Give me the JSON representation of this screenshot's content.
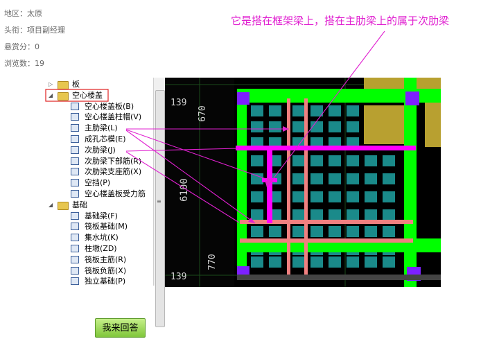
{
  "info": {
    "region": "地区：太原",
    "title": "头衔：项目副经理",
    "reward": "悬赏分：0",
    "views": "浏览数：19"
  },
  "annotation": "它是搭在框架梁上，搭在主肋梁上的属于次肋梁",
  "tree": {
    "items": [
      {
        "label": "板",
        "level": 0,
        "folder": true,
        "expanded": false
      },
      {
        "label": "空心楼盖",
        "level": 0,
        "folder": true,
        "expanded": true
      },
      {
        "label": "空心楼盖板(B)",
        "level": 1
      },
      {
        "label": "空心楼盖柱帽(V)",
        "level": 1
      },
      {
        "label": "主肋梁(L)",
        "level": 1
      },
      {
        "label": "成孔芯模(E)",
        "level": 1
      },
      {
        "label": "次肋梁(J)",
        "level": 1
      },
      {
        "label": "次肋梁下部筋(R)",
        "level": 1
      },
      {
        "label": "次肋梁支座筋(X)",
        "level": 1
      },
      {
        "label": "空挡(P)",
        "level": 1
      },
      {
        "label": "空心楼盖板受力筋",
        "level": 1
      },
      {
        "label": "基础",
        "level": 0,
        "folder": true,
        "expanded": true
      },
      {
        "label": "基础梁(F)",
        "level": 1
      },
      {
        "label": "筏板基础(M)",
        "level": 1
      },
      {
        "label": "集水坑(K)",
        "level": 1
      },
      {
        "label": "柱墩(ZD)",
        "level": 1
      },
      {
        "label": "筏板主筋(R)",
        "level": 1
      },
      {
        "label": "筏板负筋(X)",
        "level": 1
      },
      {
        "label": "独立基础(P)",
        "level": 1
      }
    ]
  },
  "cad": {
    "dims": {
      "d1": "670",
      "d2": "6100",
      "d3": "770",
      "side_top": "139",
      "side_bottom": "139"
    }
  },
  "button": {
    "answer": "我来回答"
  },
  "colors": {
    "annotation": "#e020d0",
    "green": "#00ff00",
    "magenta": "#ff00ff",
    "pink": "#f08080",
    "teal": "#1a8080",
    "purple": "#8000ff"
  }
}
